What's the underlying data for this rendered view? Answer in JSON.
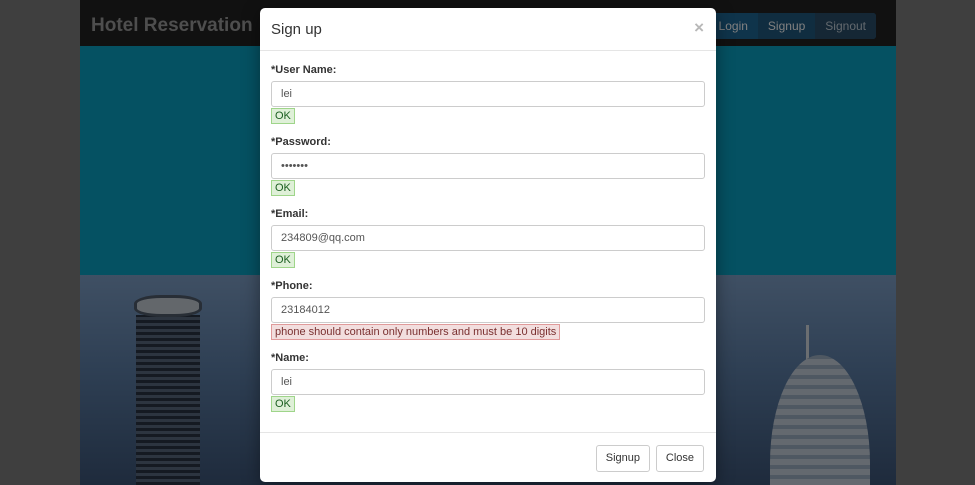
{
  "navbar": {
    "brand": "Hotel Reservation",
    "buttons": [
      "Login",
      "Signup",
      "Signout"
    ]
  },
  "modal": {
    "title": "Sign up",
    "close_icon": "×",
    "fields": [
      {
        "label": "*User Name:",
        "value": "lei",
        "status": "OK",
        "status_type": "ok"
      },
      {
        "label": "*Password:",
        "value": "•••••••",
        "status": "OK",
        "status_type": "ok"
      },
      {
        "label": "*Email:",
        "value": "234809@qq.com",
        "status": "OK",
        "status_type": "ok"
      },
      {
        "label": "*Phone:",
        "value": "23184012",
        "status": "phone should contain only numbers and must be 10 digits",
        "status_type": "error"
      },
      {
        "label": "*Name:",
        "value": "lei",
        "status": "OK",
        "status_type": "ok"
      }
    ],
    "footer": {
      "signup_label": "Signup",
      "close_label": "Close"
    }
  },
  "colors": {
    "hero": "#0aa3c4",
    "navbar": "#222222",
    "ok_bg": "#dff0d8",
    "error_bg": "#f2dede"
  }
}
